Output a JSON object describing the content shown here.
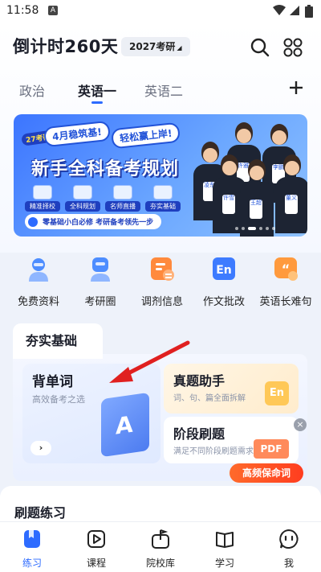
{
  "status_bar": {
    "time": "11:58",
    "notif_icon": "A"
  },
  "header": {
    "countdown": "倒计时260天",
    "year_select": "2027考研",
    "tabs": [
      {
        "label": "政治"
      },
      {
        "label": "英语一"
      },
      {
        "label": "英语二"
      }
    ]
  },
  "banner": {
    "year_badge": "27考研",
    "pill1": "4月稳筑基!",
    "pill2": "轻松赢上岸!",
    "headline": "新手全科备考规划",
    "chips": [
      "精准择校",
      "全科规划",
      "名师直播",
      "夯实基础"
    ],
    "tagline": "零基础小白必修  考研备考领先一步",
    "teachers": [
      "许雅",
      "李鹏",
      "凌东",
      "许雪",
      "王超",
      "董义",
      "新奥之"
    ]
  },
  "quick_links": [
    {
      "label": "免费资料",
      "icon": "teacher-avatar-icon",
      "color": "#4d8dff"
    },
    {
      "label": "考研圈",
      "icon": "chat-avatar-icon",
      "color": "#4d8dff"
    },
    {
      "label": "调剂信息",
      "icon": "document-list-icon",
      "color": "#ff8a3d"
    },
    {
      "label": "作文批改",
      "icon": "en-note-icon",
      "color": "#3d7bff"
    },
    {
      "label": "英语长难句",
      "icon": "quote-bubble-icon",
      "color": "#ff9a3d"
    }
  ],
  "foundation": {
    "title": "夯实基础",
    "vocab": {
      "title": "背单词",
      "subtitle": "高效备考之选",
      "go": "›"
    },
    "exam": {
      "title": "真题助手",
      "subtitle": "词、句、篇全面拆解",
      "badge": "En"
    },
    "stage": {
      "title": "阶段刷题",
      "subtitle": "满足不同阶段刷题需求",
      "badge": "PDF"
    },
    "close": "×",
    "hot_words": "高频保命词"
  },
  "practice": {
    "title": "刷题练习"
  },
  "tabbar": [
    {
      "label": "练习",
      "active": true
    },
    {
      "label": "课程",
      "active": false
    },
    {
      "label": "院校库",
      "active": false
    },
    {
      "label": "学习",
      "active": false
    },
    {
      "label": "我",
      "active": false
    }
  ],
  "colors": {
    "accent": "#2d6bff",
    "arrow": "#e02020"
  }
}
